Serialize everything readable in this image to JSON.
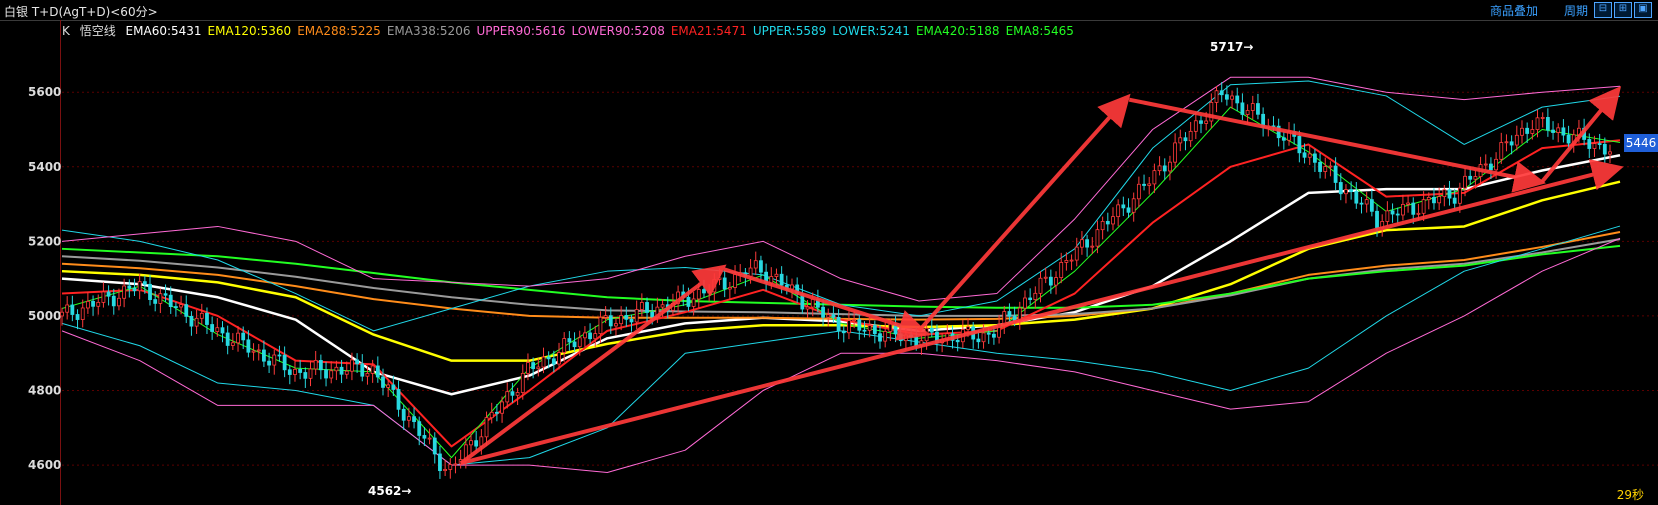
{
  "header": {
    "title": "白银 T+D(AgT+D)<60分>",
    "links": [
      "商品叠加",
      "周期"
    ],
    "window_buttons": [
      "⊟",
      "⊞",
      "▣"
    ]
  },
  "legend": {
    "k_label": "K",
    "indicator_name": "悟空线",
    "items": [
      {
        "label": "EMA60:5431",
        "color": "#ffffff"
      },
      {
        "label": "EMA120:5360",
        "color": "#ffff00"
      },
      {
        "label": "EMA288:5225",
        "color": "#ff8c1a"
      },
      {
        "label": "EMA338:5206",
        "color": "#9a9a9a"
      },
      {
        "label": "UPPER90:5616",
        "color": "#ff6ad5"
      },
      {
        "label": "LOWER90:5208",
        "color": "#ff6ad5"
      },
      {
        "label": "EMA21:5471",
        "color": "#ff2222"
      },
      {
        "label": "UPPER:5589",
        "color": "#20d8e8"
      },
      {
        "label": "LOWER:5241",
        "color": "#20d8e8"
      },
      {
        "label": "EMA420:5188",
        "color": "#22ff22"
      },
      {
        "label": "EMA8:5465",
        "color": "#22ff22"
      }
    ]
  },
  "current_price": "5446",
  "annotations": {
    "high_label": "5717→",
    "low_label": "4562→"
  },
  "timer": "29秒",
  "colors": {
    "up": "#ff3b3b",
    "down": "#28d8e0",
    "arrow": "#ff3a3a",
    "axis": "#7a1010",
    "grid": "#5a0000"
  },
  "chart_data": {
    "type": "line",
    "title": "",
    "xlabel": "",
    "ylabel": "",
    "ylim": [
      4560,
      5740
    ],
    "yticks": [
      4600,
      4800,
      5000,
      5200,
      5400,
      5600
    ],
    "x": [
      0,
      5,
      10,
      15,
      20,
      25,
      30,
      35,
      40,
      45,
      50,
      55,
      60,
      65,
      70,
      75,
      80,
      85,
      90,
      95,
      100
    ],
    "series": [
      {
        "name": "EMA60",
        "color": "#ffffff",
        "width": 2.5,
        "values": [
          5100,
          5085,
          5050,
          4990,
          4850,
          4790,
          4840,
          4940,
          4980,
          4995,
          4985,
          4960,
          4975,
          5010,
          5080,
          5200,
          5330,
          5340,
          5340,
          5390,
          5431
        ]
      },
      {
        "name": "EMA120",
        "color": "#ffff00",
        "width": 2.5,
        "values": [
          5120,
          5110,
          5090,
          5050,
          4950,
          4880,
          4880,
          4925,
          4960,
          4975,
          4975,
          4970,
          4975,
          4990,
          5020,
          5085,
          5180,
          5230,
          5240,
          5310,
          5360
        ]
      },
      {
        "name": "EMA288",
        "color": "#ff8c1a",
        "width": 2,
        "values": [
          5140,
          5128,
          5110,
          5080,
          5045,
          5020,
          5000,
          4995,
          4995,
          4995,
          4992,
          4990,
          4992,
          5000,
          5020,
          5060,
          5110,
          5135,
          5150,
          5185,
          5225
        ]
      },
      {
        "name": "EMA338",
        "color": "#9a9a9a",
        "width": 2,
        "values": [
          5160,
          5148,
          5130,
          5105,
          5075,
          5050,
          5030,
          5015,
          5012,
          5010,
          5005,
          5000,
          5000,
          5005,
          5020,
          5055,
          5100,
          5125,
          5140,
          5170,
          5206
        ]
      },
      {
        "name": "EMA420",
        "color": "#22ff22",
        "width": 2,
        "values": [
          5180,
          5170,
          5160,
          5140,
          5115,
          5090,
          5070,
          5050,
          5040,
          5035,
          5030,
          5025,
          5022,
          5022,
          5030,
          5060,
          5100,
          5120,
          5135,
          5165,
          5188
        ]
      },
      {
        "name": "EMA21",
        "color": "#ff2222",
        "width": 2,
        "values": [
          5060,
          5070,
          5000,
          4880,
          4870,
          4650,
          4800,
          4960,
          5010,
          5070,
          4990,
          4950,
          4960,
          5060,
          5250,
          5400,
          5460,
          5320,
          5330,
          5450,
          5471
        ]
      },
      {
        "name": "EMA8",
        "color": "#22ff22",
        "width": 1,
        "values": [
          5020,
          5080,
          4950,
          4860,
          4850,
          4620,
          4860,
          4990,
          5030,
          5110,
          4980,
          4940,
          4960,
          5120,
          5330,
          5560,
          5440,
          5280,
          5340,
          5500,
          5465
        ]
      },
      {
        "name": "UPPER",
        "color": "#20d8e8",
        "width": 1,
        "values": [
          5230,
          5200,
          5150,
          5060,
          4960,
          5020,
          5080,
          5120,
          5130,
          5110,
          5030,
          5000,
          5040,
          5180,
          5450,
          5620,
          5630,
          5590,
          5460,
          5560,
          5589
        ]
      },
      {
        "name": "LOWER",
        "color": "#20d8e8",
        "width": 1,
        "values": [
          4980,
          4920,
          4820,
          4800,
          4760,
          4600,
          4620,
          4700,
          4900,
          4930,
          4960,
          4930,
          4900,
          4880,
          4850,
          4800,
          4860,
          5000,
          5120,
          5180,
          5241
        ]
      },
      {
        "name": "UPPER90",
        "color": "#ff6ad5",
        "width": 1,
        "values": [
          5200,
          5220,
          5240,
          5200,
          5100,
          5090,
          5080,
          5100,
          5160,
          5200,
          5100,
          5040,
          5060,
          5260,
          5500,
          5640,
          5640,
          5600,
          5580,
          5600,
          5616
        ]
      },
      {
        "name": "LOWER90",
        "color": "#ff6ad5",
        "width": 1,
        "values": [
          4960,
          4880,
          4760,
          4760,
          4760,
          4600,
          4600,
          4580,
          4640,
          4800,
          4900,
          4900,
          4880,
          4850,
          4800,
          4750,
          4770,
          4900,
          5000,
          5120,
          5208
        ]
      },
      {
        "name": "Price",
        "color": "#ff3b3b",
        "width": 1,
        "values": [
          5000,
          5080,
          4960,
          4850,
          4860,
          4580,
          4850,
          4980,
          5040,
          5130,
          4980,
          4940,
          4950,
          5150,
          5350,
          5600,
          5450,
          5260,
          5330,
          5520,
          5446
        ]
      }
    ],
    "arrows": [
      {
        "from": [
          25.6,
          4605
        ],
        "to": [
          42.5,
          5125
        ]
      },
      {
        "from": [
          42.5,
          5125
        ],
        "to": [
          55.5,
          4955
        ]
      },
      {
        "from": [
          55.0,
          4960
        ],
        "to": [
          68.5,
          5580
        ]
      },
      {
        "from": [
          68.5,
          5580
        ],
        "to": [
          95.0,
          5360
        ]
      },
      {
        "from": [
          25.6,
          4605
        ],
        "to": [
          100.0,
          5395
        ]
      },
      {
        "from": [
          95.0,
          5360
        ],
        "to": [
          100.0,
          5600
        ]
      }
    ]
  }
}
